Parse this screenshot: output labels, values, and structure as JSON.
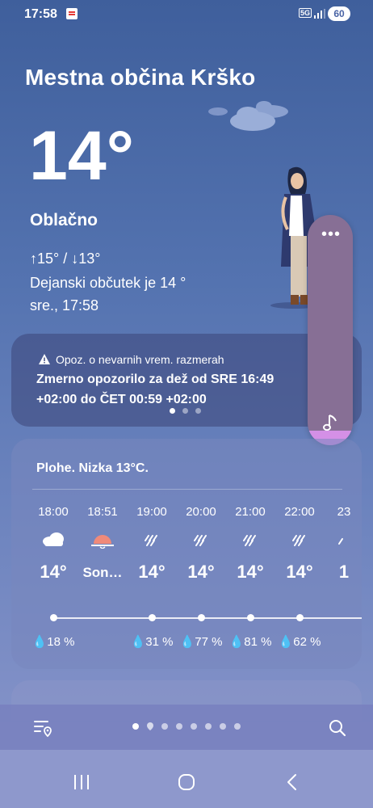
{
  "status_bar": {
    "time": "17:58",
    "network": "5G",
    "battery": "60"
  },
  "weather": {
    "location": "Mestna občina Krško",
    "temperature": "14°",
    "condition": "Oblačno",
    "high_low": "↑15° / ↓13°",
    "feels_like": "Dejanski občutek je 14 °",
    "datetime": "sre., 17:58"
  },
  "alert": {
    "heading": "Opoz. o nevarnih vrem. razmerah",
    "body": "Zmerno opozorilo za dež od SRE 16:49 +02:00 do ČET 00:59 +02:00",
    "page_count": 3,
    "active_page": 1
  },
  "forecast": {
    "summary": "Plohe. Nizka 13°C.",
    "hours": [
      {
        "time": "18:00",
        "icon": "cloud-icon",
        "temp": "14°",
        "precip": "18 %"
      },
      {
        "time": "18:51",
        "icon": "sunset-icon",
        "temp": "Son…",
        "precip": ""
      },
      {
        "time": "19:00",
        "icon": "rain-icon",
        "temp": "14°",
        "precip": "31 %"
      },
      {
        "time": "20:00",
        "icon": "rain-icon",
        "temp": "14°",
        "precip": "77 %"
      },
      {
        "time": "21:00",
        "icon": "rain-icon",
        "temp": "14°",
        "precip": "81 %"
      },
      {
        "time": "22:00",
        "icon": "rain-icon",
        "temp": "14°",
        "precip": "62 %"
      },
      {
        "time": "23",
        "icon": "rain-icon",
        "temp": "1",
        "precip": ""
      }
    ]
  },
  "colors": {
    "accent_pink": "#d490e6",
    "side_panel": "#876f95"
  }
}
